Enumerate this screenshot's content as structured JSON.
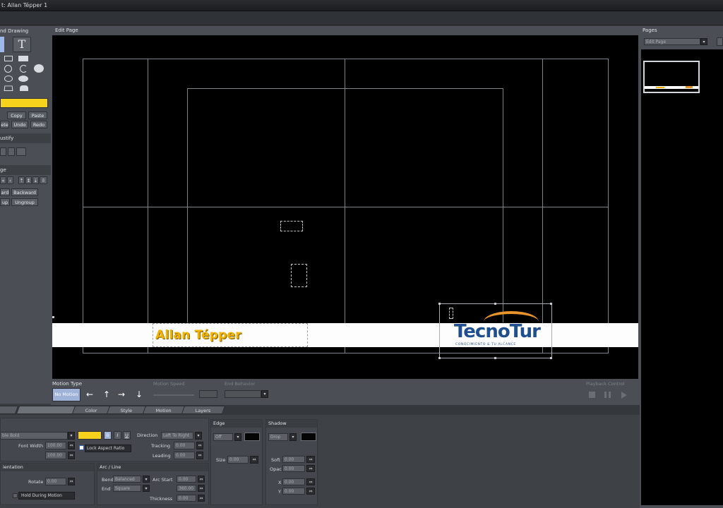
{
  "window": {
    "title": "t: Allan Tépper 1"
  },
  "left_panel": {
    "drawing_label": "nd Drawing",
    "text_tool_label": "T",
    "fill_color": "#f6d21c",
    "edit_buttons": [
      "Copy",
      "Paste"
    ],
    "edit_buttons_row2": [
      "ete",
      "Undo",
      "Redo"
    ],
    "justify_label": "ustify",
    "arrange_label": "ge",
    "arrange_row2": [
      "ard",
      "Backward"
    ],
    "arrange_row3": [
      "up",
      "Ungroup"
    ]
  },
  "canvas": {
    "label": "Edit Page",
    "lower_third_name": "Allan Tépper",
    "logo_main": "TecnoTur",
    "logo_sub": "CONOCIMIENTO & TU ALCANCE",
    "name_color": "#f2b400",
    "logo_color": "#1f4f8f",
    "logo_accent": "#e8942a"
  },
  "pages_panel": {
    "label": "Pages",
    "dropdown": "Edit Page"
  },
  "motion": {
    "type_label": "Motion Type",
    "no_motion": "No Motion",
    "arrows": [
      "←",
      "↑",
      "→",
      "↓"
    ],
    "speed_label": "Motion Speed",
    "behavior_label": "End Behavior",
    "playback_label": "Playback Control"
  },
  "tabs": [
    "",
    "",
    "Color",
    "Style",
    "Motion",
    "Layers"
  ],
  "font_section": {
    "font_field": "ble Bold",
    "font_color": "#f6d21c",
    "style_buttons": [
      "B",
      "I",
      "U"
    ],
    "font_width_label": "Font Width",
    "lock_aspect_label": "Lock Aspect Ratio",
    "direction_label": "Direction",
    "direction_value": "Left To Right",
    "tracking_label": "Tracking",
    "leading_label": "Leading",
    "tracking_value": "0.00",
    "leading_value": "0.00",
    "value_1": "100.00",
    "value_2": "100.00"
  },
  "edge": {
    "header": "Edge",
    "size_label": "Size",
    "type_value": "Off",
    "size_value": "0.00",
    "color": "#050505"
  },
  "shadow": {
    "header": "Shadow",
    "type_value": "Drop",
    "color": "#050505",
    "soft_label": "Soft",
    "soft_value": "0.00",
    "opac_label": "Opac",
    "opac_value": "0.00",
    "x_label": "X",
    "x_value": "0.00",
    "y_label": "Y",
    "y_value": "0.00"
  },
  "orientation": {
    "header": "ientation",
    "rotate_label": "Rotate",
    "rotate_value": "0.00",
    "hold_label": "Hold During Motion"
  },
  "arc": {
    "header": "Arc / Line",
    "bend_label": "Bend",
    "bend_value": "Balanced",
    "end_label": "End",
    "end_value": "Square",
    "arc_start_label": "Arc Start",
    "arc_start_value": "0.00",
    "arc_end_value": "360.00",
    "thickness_label": "Thickness",
    "thickness_value": "0.00"
  }
}
